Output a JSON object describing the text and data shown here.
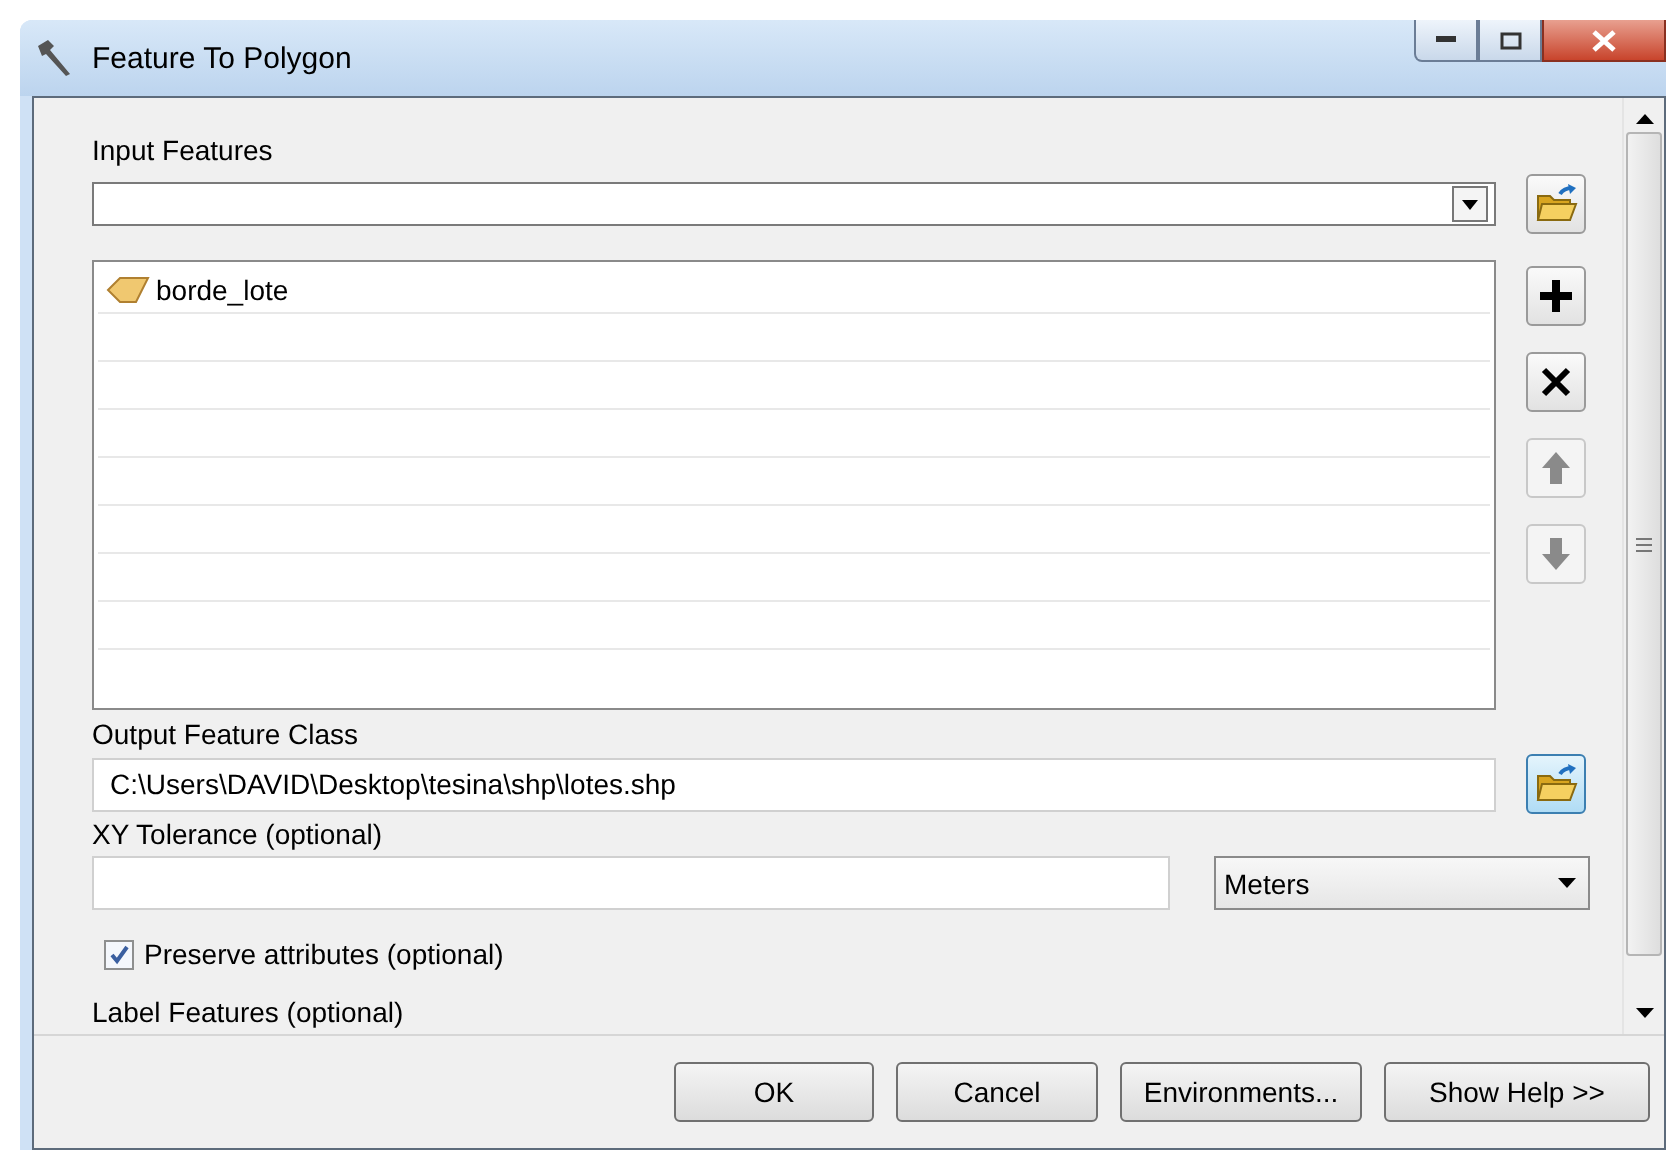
{
  "window": {
    "title": "Feature To Polygon"
  },
  "input_features": {
    "label": "Input Features",
    "items": [
      {
        "name": "borde_lote"
      }
    ]
  },
  "list_buttons": [
    {
      "kind": "add",
      "disabled": false
    },
    {
      "kind": "remove",
      "disabled": false
    },
    {
      "kind": "up",
      "disabled": true
    },
    {
      "kind": "down",
      "disabled": true
    }
  ],
  "output_feature_class": {
    "label": "Output Feature Class",
    "value": "C:\\Users\\DAVID\\Desktop\\tesina\\shp\\lotes.shp"
  },
  "xy_tolerance": {
    "label": "XY Tolerance (optional)",
    "unit": "Meters"
  },
  "preserve_attributes": {
    "label": "Preserve attributes (optional)",
    "checked": true
  },
  "label_features": {
    "label": "Label Features (optional)"
  },
  "buttons": [
    "OK",
    "Cancel",
    "Environments...",
    "Show Help >>"
  ]
}
